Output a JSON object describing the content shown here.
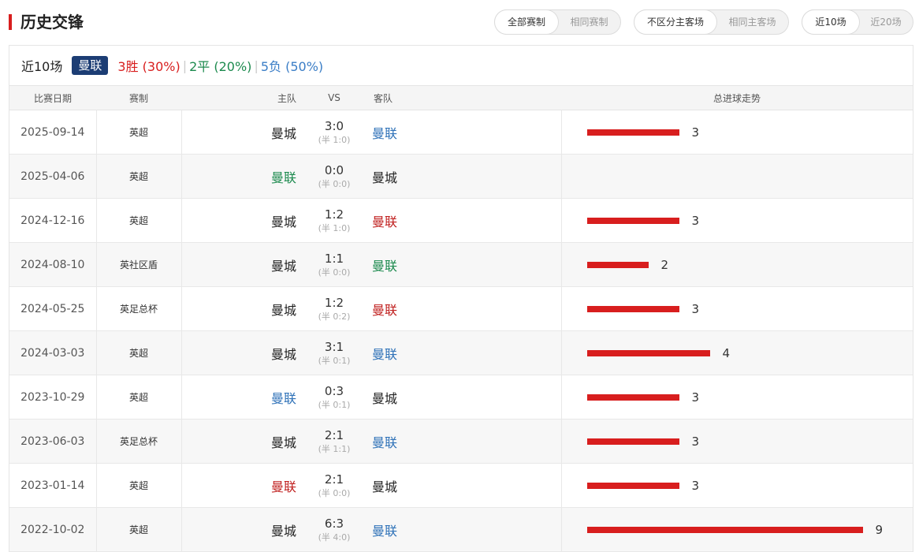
{
  "header": {
    "title": "历史交锋",
    "filter_competition": [
      "全部赛制",
      "相同赛制"
    ],
    "filter_venue": [
      "不区分主客场",
      "相同主客场"
    ],
    "filter_count": [
      "近10场",
      "近20场"
    ]
  },
  "summary": {
    "label": "近10场",
    "team": "曼联",
    "win": "3胜 (30%)",
    "draw": "2平 (20%)",
    "lose": "5负 (50%)",
    "sep": "|"
  },
  "columns": [
    "比赛日期",
    "赛制",
    "主队",
    "VS",
    "客队",
    "总进球走势"
  ],
  "colors": {
    "accent": "#d81e1e",
    "badge": "#1c3d74",
    "win": "#c0201f",
    "draw": "#1c8a4e",
    "lose": "#2f72b8"
  },
  "matches": [
    {
      "date": "2025-09-14",
      "comp": "英超",
      "home": "曼城",
      "score": "3:0",
      "half": "(半 1:0)",
      "away": "曼联",
      "total": "3",
      "total_value": 3,
      "home_color": "black",
      "away_color": "blue"
    },
    {
      "date": "2025-04-06",
      "comp": "英超",
      "home": "曼联",
      "score": "0:0",
      "half": "(半 0:0)",
      "away": "曼城",
      "total": "",
      "total_value": 0,
      "home_color": "green",
      "away_color": "black"
    },
    {
      "date": "2024-12-16",
      "comp": "英超",
      "home": "曼城",
      "score": "1:2",
      "half": "(半 1:0)",
      "away": "曼联",
      "total": "3",
      "total_value": 3,
      "home_color": "black",
      "away_color": "red"
    },
    {
      "date": "2024-08-10",
      "comp": "英社区盾",
      "home": "曼城",
      "score": "1:1",
      "half": "(半 0:0)",
      "away": "曼联",
      "total": "2",
      "total_value": 2,
      "home_color": "black",
      "away_color": "green"
    },
    {
      "date": "2024-05-25",
      "comp": "英足总杯",
      "home": "曼城",
      "score": "1:2",
      "half": "(半 0:2)",
      "away": "曼联",
      "total": "3",
      "total_value": 3,
      "home_color": "black",
      "away_color": "red"
    },
    {
      "date": "2024-03-03",
      "comp": "英超",
      "home": "曼城",
      "score": "3:1",
      "half": "(半 0:1)",
      "away": "曼联",
      "total": "4",
      "total_value": 4,
      "home_color": "black",
      "away_color": "blue"
    },
    {
      "date": "2023-10-29",
      "comp": "英超",
      "home": "曼联",
      "score": "0:3",
      "half": "(半 0:1)",
      "away": "曼城",
      "total": "3",
      "total_value": 3,
      "home_color": "blue",
      "away_color": "black"
    },
    {
      "date": "2023-06-03",
      "comp": "英足总杯",
      "home": "曼城",
      "score": "2:1",
      "half": "(半 1:1)",
      "away": "曼联",
      "total": "3",
      "total_value": 3,
      "home_color": "black",
      "away_color": "blue"
    },
    {
      "date": "2023-01-14",
      "comp": "英超",
      "home": "曼联",
      "score": "2:1",
      "half": "(半 0:0)",
      "away": "曼城",
      "total": "3",
      "total_value": 3,
      "home_color": "red",
      "away_color": "black"
    },
    {
      "date": "2022-10-02",
      "comp": "英超",
      "home": "曼城",
      "score": "6:3",
      "half": "(半 4:0)",
      "away": "曼联",
      "total": "9",
      "total_value": 9,
      "home_color": "black",
      "away_color": "blue"
    }
  ]
}
